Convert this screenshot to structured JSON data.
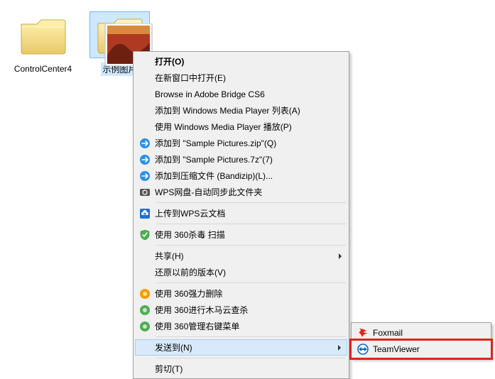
{
  "desktop": {
    "items": [
      {
        "label": "ControlCenter4"
      },
      {
        "label": "示例图片"
      }
    ]
  },
  "context_menu": {
    "items": [
      {
        "label": "打开(O)",
        "bold": true
      },
      {
        "label": "在新窗口中打开(E)"
      },
      {
        "label": "Browse in Adobe Bridge CS6"
      },
      {
        "label": "添加到 Windows Media Player 列表(A)"
      },
      {
        "label": "使用 Windows Media Player 播放(P)"
      },
      {
        "label": "添加到 \"Sample Pictures.zip\"(Q)",
        "icon": "bandizip-arrow-icon"
      },
      {
        "label": "添加到 \"Sample Pictures.7z\"(7)",
        "icon": "bandizip-arrow-icon"
      },
      {
        "label": "添加到压缩文件 (Bandizip)(L)...",
        "icon": "bandizip-arrow-icon"
      },
      {
        "label": "WPS网盘-自动同步此文件夹",
        "icon": "wps-sync-icon"
      },
      {
        "sep": true
      },
      {
        "label": "上传到WPS云文档",
        "icon": "wps-cloud-icon"
      },
      {
        "sep": true
      },
      {
        "label": "使用 360杀毒 扫描",
        "icon": "shield-360-icon"
      },
      {
        "sep": true
      },
      {
        "label": "共享(H)",
        "arrow": true
      },
      {
        "label": "还原以前的版本(V)"
      },
      {
        "sep": true
      },
      {
        "label": "使用 360强力删除",
        "icon": "orb-360-orange-icon"
      },
      {
        "label": "使用 360进行木马云查杀",
        "icon": "orb-360-green-icon"
      },
      {
        "label": "使用 360管理右键菜单",
        "icon": "orb-360-green-icon"
      },
      {
        "sep": true
      },
      {
        "label": "发送到(N)",
        "arrow": true,
        "hover": true
      },
      {
        "sep": true
      },
      {
        "label": "剪切(T)"
      }
    ]
  },
  "submenu": {
    "items": [
      {
        "label": "Foxmail",
        "icon": "foxmail-icon"
      },
      {
        "label": "TeamViewer",
        "icon": "teamviewer-icon"
      }
    ]
  }
}
